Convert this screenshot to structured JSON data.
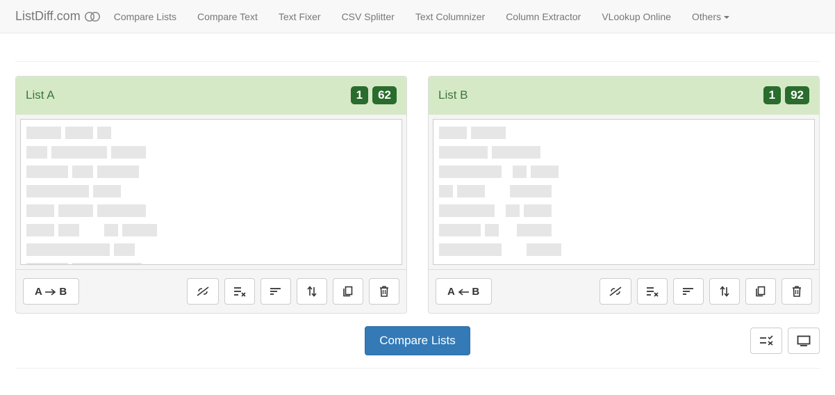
{
  "brand": "ListDiff.com",
  "nav": {
    "items": [
      "Compare Lists",
      "Compare Text",
      "Text Fixer",
      "CSV Splitter",
      "Text Columnizer",
      "Column Extractor",
      "VLookup Online",
      "Others"
    ]
  },
  "panel_a": {
    "title": "List A",
    "badge_cols": "1",
    "badge_rows": "62",
    "move_label_a": "A",
    "move_label_b": "B"
  },
  "panel_b": {
    "title": "List B",
    "badge_cols": "1",
    "badge_rows": "92",
    "move_label_a": "A",
    "move_label_b": "B"
  },
  "actions": {
    "compare": "Compare Lists"
  }
}
